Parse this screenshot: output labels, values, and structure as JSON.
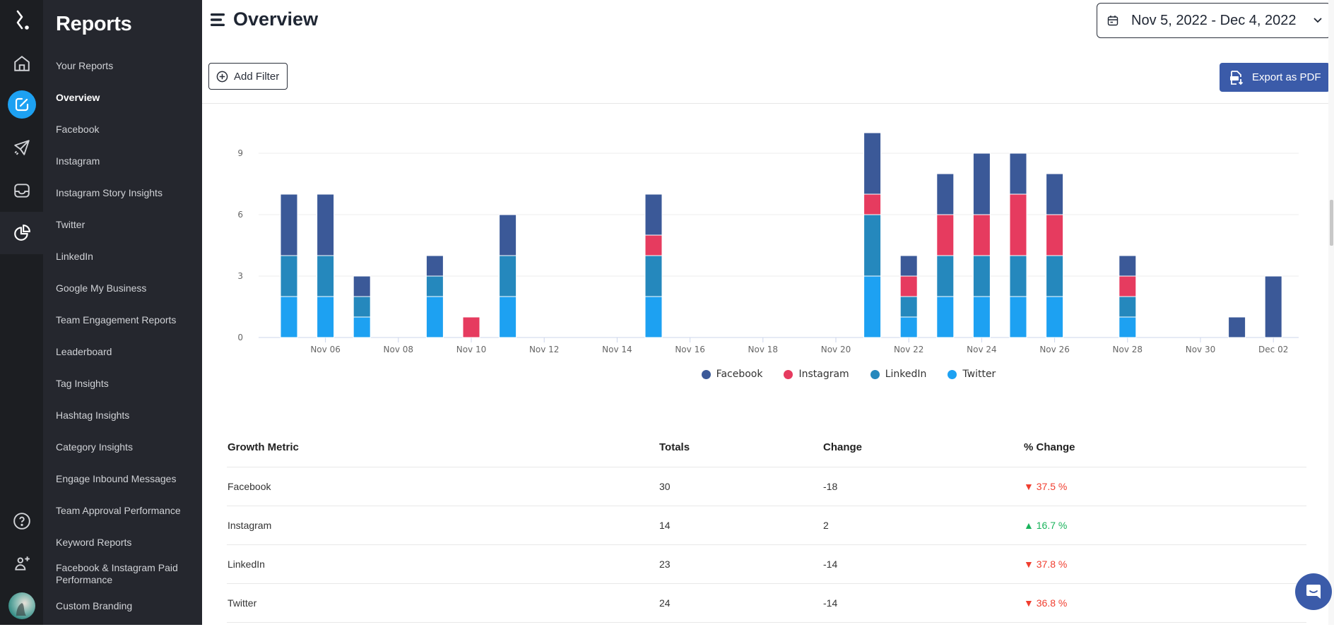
{
  "rail": {
    "icons": [
      "logo-icon",
      "home-icon",
      "compose-icon",
      "send-icon",
      "inbox-icon",
      "reports-icon",
      "help-icon",
      "add-user-icon",
      "avatar"
    ]
  },
  "sidebar": {
    "title": "Reports",
    "items": [
      {
        "label": "Your Reports"
      },
      {
        "label": "Overview",
        "active": true
      },
      {
        "label": "Facebook"
      },
      {
        "label": "Instagram"
      },
      {
        "label": "Instagram Story Insights"
      },
      {
        "label": "Twitter"
      },
      {
        "label": "LinkedIn"
      },
      {
        "label": "Google My Business"
      },
      {
        "label": "Team Engagement Reports"
      },
      {
        "label": "Leaderboard"
      },
      {
        "label": "Tag Insights"
      },
      {
        "label": "Hashtag Insights"
      },
      {
        "label": "Category Insights"
      },
      {
        "label": "Engage Inbound Messages"
      },
      {
        "label": "Team Approval Performance"
      },
      {
        "label": "Keyword Reports"
      },
      {
        "label": "Facebook & Instagram Paid Performance"
      },
      {
        "label": "Custom Branding"
      }
    ]
  },
  "header": {
    "title": "Overview",
    "date_range": "Nov 5, 2022 - Dec 4, 2022",
    "add_filter": "Add Filter",
    "export": "Export as PDF"
  },
  "colors": {
    "Facebook": "#3b5998",
    "Instagram": "#e63b5f",
    "LinkedIn": "#2588bd",
    "Twitter": "#1da1f2",
    "accent": "#3b5ba9",
    "negative": "#f03e2f",
    "positive": "#19b35b"
  },
  "chart_data": {
    "type": "bar",
    "stacked": true,
    "title": "",
    "xlabel": "",
    "ylabel": "",
    "ylim": [
      0,
      10
    ],
    "yticks": [
      0,
      3,
      6,
      9
    ],
    "grid": true,
    "legend_position": "bottom",
    "categories": [
      "Nov 05",
      "Nov 06",
      "Nov 07",
      "Nov 08",
      "Nov 09",
      "Nov 10",
      "Nov 11",
      "Nov 12",
      "Nov 13",
      "Nov 14",
      "Nov 15",
      "Nov 16",
      "Nov 17",
      "Nov 18",
      "Nov 19",
      "Nov 20",
      "Nov 21",
      "Nov 22",
      "Nov 23",
      "Nov 24",
      "Nov 25",
      "Nov 26",
      "Nov 27",
      "Nov 28",
      "Nov 29",
      "Nov 30",
      "Dec 01",
      "Dec 02"
    ],
    "xtick_labels": [
      "Nov 06",
      "Nov 08",
      "Nov 10",
      "Nov 12",
      "Nov 14",
      "Nov 16",
      "Nov 18",
      "Nov 20",
      "Nov 22",
      "Nov 24",
      "Nov 26",
      "Nov 28",
      "Nov 30",
      "Dec 02"
    ],
    "series": [
      {
        "name": "Twitter",
        "values": [
          2,
          2,
          1,
          0,
          2,
          0,
          2,
          0,
          0,
          0,
          2,
          0,
          0,
          0,
          0,
          0,
          3,
          1,
          2,
          2,
          2,
          2,
          0,
          1,
          0,
          0,
          0,
          0
        ]
      },
      {
        "name": "LinkedIn",
        "values": [
          2,
          2,
          1,
          0,
          1,
          0,
          2,
          0,
          0,
          0,
          2,
          0,
          0,
          0,
          0,
          0,
          3,
          1,
          2,
          2,
          2,
          2,
          0,
          1,
          0,
          0,
          0,
          0
        ]
      },
      {
        "name": "Instagram",
        "values": [
          0,
          0,
          0,
          0,
          0,
          1,
          0,
          0,
          0,
          0,
          1,
          0,
          0,
          0,
          0,
          0,
          1,
          1,
          2,
          2,
          3,
          2,
          0,
          1,
          0,
          0,
          0,
          0
        ]
      },
      {
        "name": "Facebook",
        "values": [
          3,
          3,
          1,
          0,
          1,
          0,
          2,
          0,
          0,
          0,
          2,
          0,
          0,
          0,
          0,
          0,
          3,
          1,
          2,
          3,
          2,
          2,
          0,
          1,
          0,
          0,
          1,
          3
        ]
      }
    ],
    "legend": [
      "Facebook",
      "Instagram",
      "LinkedIn",
      "Twitter"
    ]
  },
  "table": {
    "headers": [
      "Growth Metric",
      "Totals",
      "Change",
      "% Change"
    ],
    "rows": [
      {
        "metric": "Facebook",
        "total": "30",
        "change": "-18",
        "pct": "37.5 %",
        "dir": "down"
      },
      {
        "metric": "Instagram",
        "total": "14",
        "change": "2",
        "pct": "16.7 %",
        "dir": "up"
      },
      {
        "metric": "LinkedIn",
        "total": "23",
        "change": "-14",
        "pct": "37.8 %",
        "dir": "down"
      },
      {
        "metric": "Twitter",
        "total": "24",
        "change": "-14",
        "pct": "36.8 %",
        "dir": "down"
      }
    ]
  }
}
